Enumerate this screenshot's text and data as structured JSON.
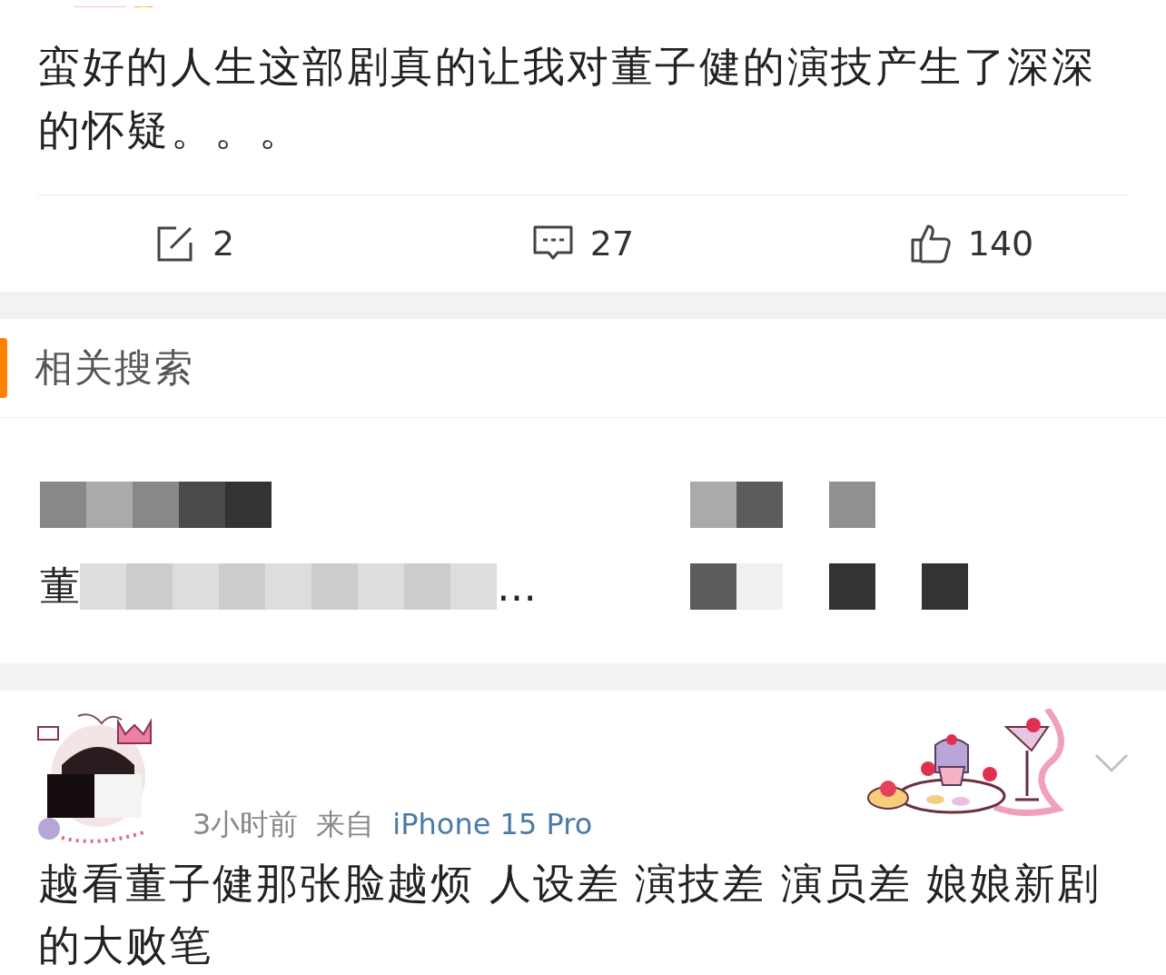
{
  "post": {
    "kind": "picture",
    "text": "蛮好的人生这部剧真的让我对董子健的演技产生了深深的怀疑。。。",
    "actions": [
      {
        "kind": "repost",
        "count": "2"
      },
      {
        "kind": "comment",
        "count": "27"
      },
      {
        "kind": "like",
        "count": "140"
      }
    ]
  },
  "related_searches": {
    "title": "相关搜索",
    "items": [
      {
        "kind": "redacted"
      },
      {
        "kind": "redacted"
      },
      {
        "kind": "partial",
        "lead": "董",
        "tail": "…"
      },
      {
        "kind": "redacted"
      }
    ]
  },
  "comment": {
    "time": "3小时前",
    "source_label": "来自",
    "source": "iPhone 15 Pro",
    "text": "越看董子健那张脸越烦 人设差 演技差 演员差  娘娘新剧的大败笔"
  }
}
